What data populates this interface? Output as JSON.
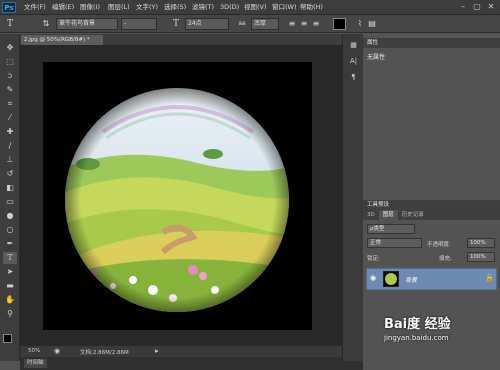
{
  "app": {
    "logo": "Ps"
  },
  "menu": [
    "文件(F)",
    "编辑(E)",
    "图像(I)",
    "图层(L)",
    "文字(Y)",
    "选择(S)",
    "滤镜(T)",
    "3D(D)",
    "视图(V)",
    "窗口(W)",
    "帮助(H)"
  ],
  "window_controls": {
    "minimize": "–",
    "maximize": "▢",
    "close": "✕"
  },
  "options": {
    "tool_icon": "T",
    "font_family": "革牛花鸟背景",
    "font_style": "-",
    "font_size": "24点",
    "antialias": "浑厚",
    "color_hex": "#000000"
  },
  "document": {
    "tab_title": "2.jpg @ 50%(RGB/8#) *",
    "zoom": "50%",
    "doc_info": "文档:2.86M/2.86M"
  },
  "properties": {
    "title": "属性",
    "content": "无属性"
  },
  "layers_panel": {
    "tabs": [
      "3D",
      "图层",
      "历史记录"
    ],
    "kind_filter": "ρ类型",
    "blend_mode": "正常",
    "opacity_label": "不透明度:",
    "opacity_value": "100%",
    "lock_label": "锁定:",
    "fill_label": "填充:",
    "fill_value": "100%",
    "layer_name": "背景"
  },
  "bottom_tab": "时间轴",
  "watermark": {
    "brand": "Bai度",
    "cn": "经验",
    "url": "jingyan.baidu.com"
  },
  "colors": {
    "accent": "#31a8ff",
    "selected_layer": "#6d8bb0"
  }
}
